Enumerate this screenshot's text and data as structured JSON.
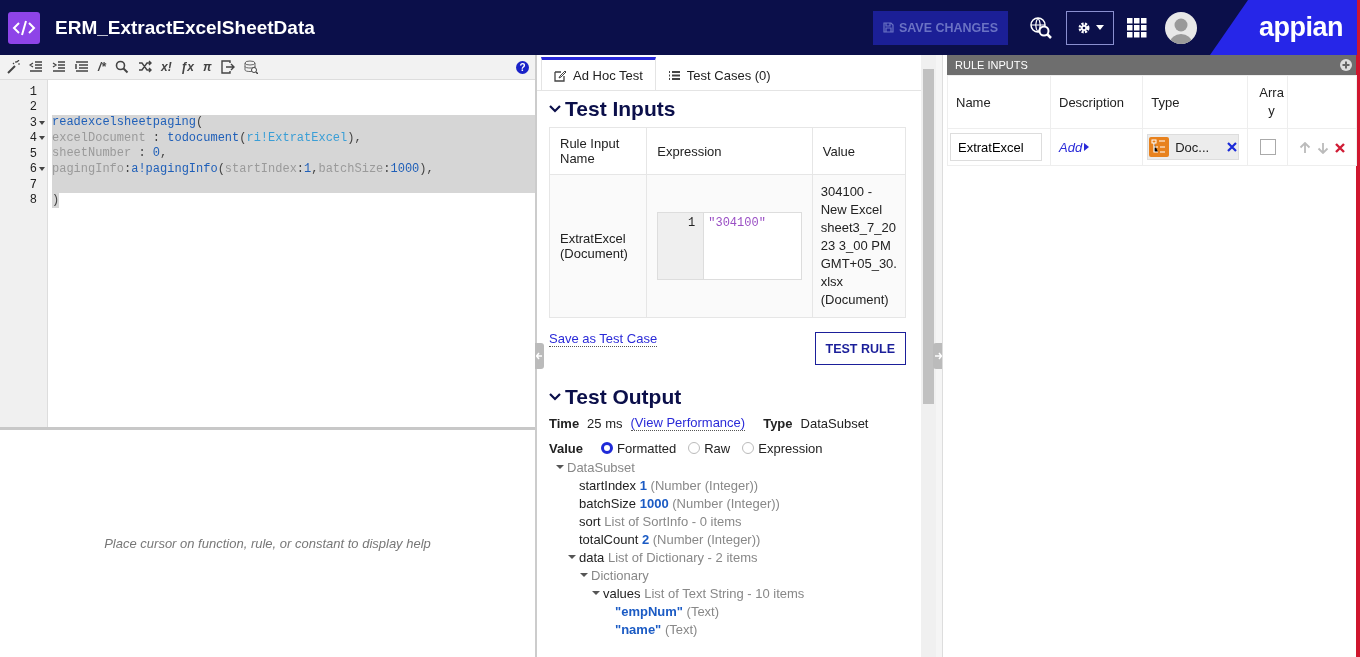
{
  "header": {
    "title": "ERM_ExtractExcelSheetData",
    "save_button": {
      "label": "SAVE CHANGES",
      "disabled": true
    },
    "logo": "appian"
  },
  "editor": {
    "toolbar_glyphs": [
      "/*",
      "x!",
      "ƒx",
      "π"
    ],
    "help_glyph": "?",
    "lines": [
      {
        "number": "1",
        "foldable": false,
        "selected": false
      },
      {
        "number": "2",
        "foldable": false,
        "selected": false
      },
      {
        "number": "3",
        "foldable": true,
        "selected": true,
        "tokens": [
          {
            "kind": "fn",
            "text": "readexcelsheetpaging"
          },
          {
            "kind": "punct",
            "text": "("
          }
        ]
      },
      {
        "number": "4",
        "foldable": true,
        "selected": true,
        "tokens": [
          {
            "kind": "param",
            "text": "excelDocument"
          },
          {
            "kind": "punct",
            "text": " : "
          },
          {
            "kind": "fn",
            "text": "todocument"
          },
          {
            "kind": "punct",
            "text": "("
          },
          {
            "kind": "ref",
            "text": "ri!ExtratExcel"
          },
          {
            "kind": "punct",
            "text": "),"
          }
        ]
      },
      {
        "number": "5",
        "foldable": false,
        "selected": true,
        "tokens": [
          {
            "kind": "param",
            "text": "sheetNumber"
          },
          {
            "kind": "punct",
            "text": " : "
          },
          {
            "kind": "num",
            "text": "0"
          },
          {
            "kind": "punct",
            "text": ","
          }
        ]
      },
      {
        "number": "6",
        "foldable": true,
        "selected": true,
        "tokens": [
          {
            "kind": "param",
            "text": "pagingInfo"
          },
          {
            "kind": "punct",
            "text": ":"
          },
          {
            "kind": "fn",
            "text": "a!pagingInfo"
          },
          {
            "kind": "punct",
            "text": "("
          },
          {
            "kind": "param",
            "text": "startIndex"
          },
          {
            "kind": "punct",
            "text": ":"
          },
          {
            "kind": "num",
            "text": "1"
          },
          {
            "kind": "punct",
            "text": ","
          },
          {
            "kind": "param",
            "text": "batchSize"
          },
          {
            "kind": "punct",
            "text": ":"
          },
          {
            "kind": "num",
            "text": "1000"
          },
          {
            "kind": "punct",
            "text": "),"
          }
        ]
      },
      {
        "number": "7",
        "foldable": false,
        "selected": true
      },
      {
        "number": "8",
        "foldable": false,
        "selected": true,
        "tokens": [
          {
            "kind": "punct",
            "text": ")"
          }
        ]
      }
    ],
    "help_text": "Place cursor on function, rule, or constant to display help"
  },
  "tabs": [
    {
      "label": "Ad Hoc Test",
      "selected": true
    },
    {
      "label": "Test Cases (0)",
      "selected": false
    }
  ],
  "test_inputs": {
    "title": "Test Inputs",
    "expanded": true,
    "columns": [
      "Rule Input Name",
      "Expression",
      "Value"
    ],
    "rows": [
      {
        "name": "ExtratExcel (Document)",
        "line_number": "1",
        "expression": "\"304100\"",
        "value": "304100 - New Excel sheet3_7_2023 3_00 PM GMT+05_30.xlsx (Document)"
      }
    ]
  },
  "save_test_case": "Save as Test Case",
  "test_button": "TEST RULE",
  "test_output": {
    "title": "Test Output",
    "expanded": true,
    "time_label": "Time",
    "time": "25 ms",
    "performance_link": "(View Performance)",
    "type_label": "Type",
    "type": "DataSubset",
    "value_label": "Value",
    "formats": [
      {
        "label": "Formatted",
        "selected": true
      },
      {
        "label": "Raw",
        "selected": false
      },
      {
        "label": "Expression",
        "selected": false
      }
    ],
    "tree": [
      {
        "detail": "DataSubset",
        "expanded": true,
        "children": [
          {
            "name": "startIndex",
            "value": "1",
            "detail": "(Number (Integer))"
          },
          {
            "name": "batchSize",
            "value": "1000",
            "detail": "(Number (Integer))"
          },
          {
            "name": "sort",
            "detail": "List of SortInfo - 0 items"
          },
          {
            "name": "totalCount",
            "value": "2",
            "detail": "(Number (Integer))"
          },
          {
            "name": "data",
            "detail": "List of Dictionary - 2 items",
            "expanded": true,
            "children": [
              {
                "detail": "Dictionary",
                "expanded": true,
                "children": [
                  {
                    "name": "values",
                    "detail": "List of Text String - 10 items",
                    "expanded": true,
                    "children": [
                      {
                        "value": "\"empNum\"",
                        "detail": "(Text)"
                      },
                      {
                        "value": "\"name\"",
                        "detail": "(Text)"
                      }
                    ]
                  }
                ]
              }
            ]
          }
        ]
      }
    ]
  },
  "rule_inputs": {
    "title": "RULE INPUTS",
    "columns": [
      "Name",
      "Description",
      "Type",
      "Array"
    ],
    "rows": [
      {
        "name": "ExtratExcel",
        "description_link": "Add",
        "type": "Doc...",
        "array": false
      }
    ]
  }
}
